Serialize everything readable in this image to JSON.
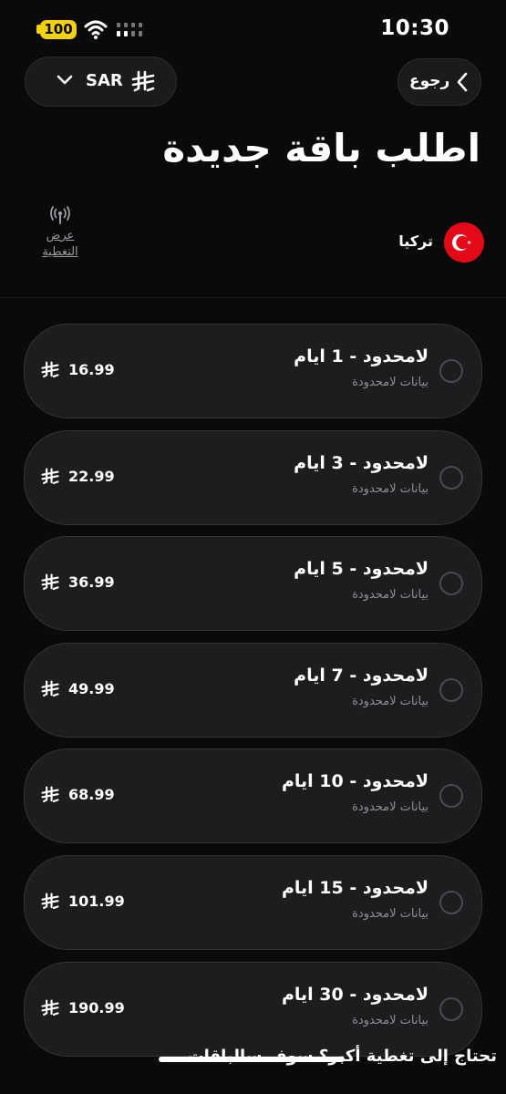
{
  "status_bar": {
    "battery": "100",
    "time": "10:30"
  },
  "header": {
    "currency_code": "SAR",
    "back_label": "رجوع",
    "title": "اطلب باقة جديدة"
  },
  "country": {
    "name": "تركيا",
    "flag": "turkey-flag"
  },
  "coverage": {
    "label_line1": "عرض",
    "label_line2": "التغطية"
  },
  "plans": [
    {
      "title": "لامحدود - 1 ايام",
      "subtitle": "بيانات لامحدودة",
      "price": "16.99"
    },
    {
      "title": "لامحدود - 3 ايام",
      "subtitle": "بيانات لامحدودة",
      "price": "22.99"
    },
    {
      "title": "لامحدود - 5 ايام",
      "subtitle": "بيانات لامحدودة",
      "price": "36.99"
    },
    {
      "title": "لامحدود - 7 ايام",
      "subtitle": "بيانات لامحدودة",
      "price": "49.99"
    },
    {
      "title": "لامحدود - 10 ايام",
      "subtitle": "بيانات لامحدودة",
      "price": "68.99"
    },
    {
      "title": "لامحدود - 15 ايام",
      "subtitle": "بيانات لامحدودة",
      "price": "101.99"
    },
    {
      "title": "لامحدود - 30 ايام",
      "subtitle": "بيانات لامحدودة",
      "price": "190.99"
    }
  ],
  "footer": {
    "note": "تحتاج إلى تغطية أكبر؟ سوف سالباقات"
  },
  "colors": {
    "background": "#0a0a0b",
    "card": "#1d1d1f",
    "battery": "#f3d20b",
    "flag_red": "#e30a17"
  }
}
